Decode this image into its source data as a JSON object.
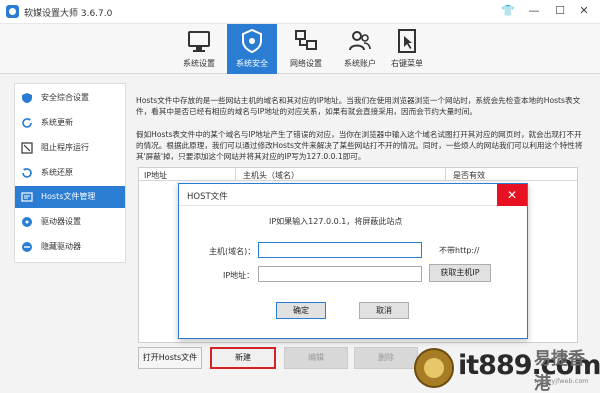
{
  "window": {
    "title": "软媒设置大师 3.6.7.0",
    "controls": {
      "shirt": "👕",
      "minimize": "—",
      "maximize": "☐",
      "close": "✕"
    }
  },
  "toolbar": {
    "tabs": [
      {
        "label": "系统设置",
        "icon": "monitor-settings-icon",
        "active": false
      },
      {
        "label": "系统安全",
        "icon": "shield-icon",
        "active": true
      },
      {
        "label": "网络设置",
        "icon": "network-icon",
        "active": false
      },
      {
        "label": "系统账户",
        "icon": "users-icon",
        "active": false
      },
      {
        "label": "右键菜单",
        "icon": "cursor-menu-icon",
        "active": false
      }
    ]
  },
  "sidebar": {
    "items": [
      {
        "label": "安全综合设置",
        "icon": "shield-settings-icon",
        "active": false
      },
      {
        "label": "系统更新",
        "icon": "refresh-icon",
        "active": false
      },
      {
        "label": "阻止程序运行",
        "icon": "block-icon",
        "active": false
      },
      {
        "label": "系统还原",
        "icon": "restore-icon",
        "active": false
      },
      {
        "label": "Hosts文件管理",
        "icon": "hosts-icon",
        "active": true
      },
      {
        "label": "驱动器设置",
        "icon": "drive-icon",
        "active": false
      },
      {
        "label": "隐藏驱动器",
        "icon": "hide-drive-icon",
        "active": false
      }
    ]
  },
  "main": {
    "description_1": "Hosts文件中存放的是一些网站主机的域名和其对应的IP地址。当我们在使用浏览器浏览一个网站时，系统会先检查本地的Hosts表文件，看其中是否已经有相应的域名与IP地址的对应关系，如果有就会直接采用，因而会节约大量时间。",
    "description_2": "假如Hosts表文件中的某个域名与IP地址产生了错误的对应，当你在浏览器中输入这个域名试图打开其对应的网页时，就会出现打不开的情况。根据此原理，我们可以通过修改Hosts文件来解决了某些网站打不开的情况。同时，一些烦人的网站我们可以利用这个特性将其'屏蔽'掉，只要添加这个网站并将其对应的IP写为127.0.0.1即可。",
    "table": {
      "columns": [
        "IP地址",
        "主机头（域名）",
        "是否有效"
      ],
      "rows": []
    },
    "buttons": {
      "open_hosts": "打开Hosts文件",
      "new": "新建",
      "edit": "编辑",
      "delete": "删除"
    }
  },
  "dialog": {
    "title": "HOST文件",
    "close": "✕",
    "info": "IP如果输入127.0.0.1，将屏蔽此站点",
    "host_label": "主机(域名)：",
    "host_value": "",
    "ip_label": "IP地址：",
    "ip_value": "",
    "note": "不带http://",
    "get_ip_button": "获取主机IP",
    "ok_button": "确定",
    "cancel_button": "取消"
  },
  "watermark": {
    "text": "it889.com",
    "cn_text": "易捷香港",
    "url": "www.yjfweb.com"
  },
  "colors": {
    "accent": "#2b7cd3",
    "highlight_border": "#d42323",
    "close_red": "#e81123"
  }
}
